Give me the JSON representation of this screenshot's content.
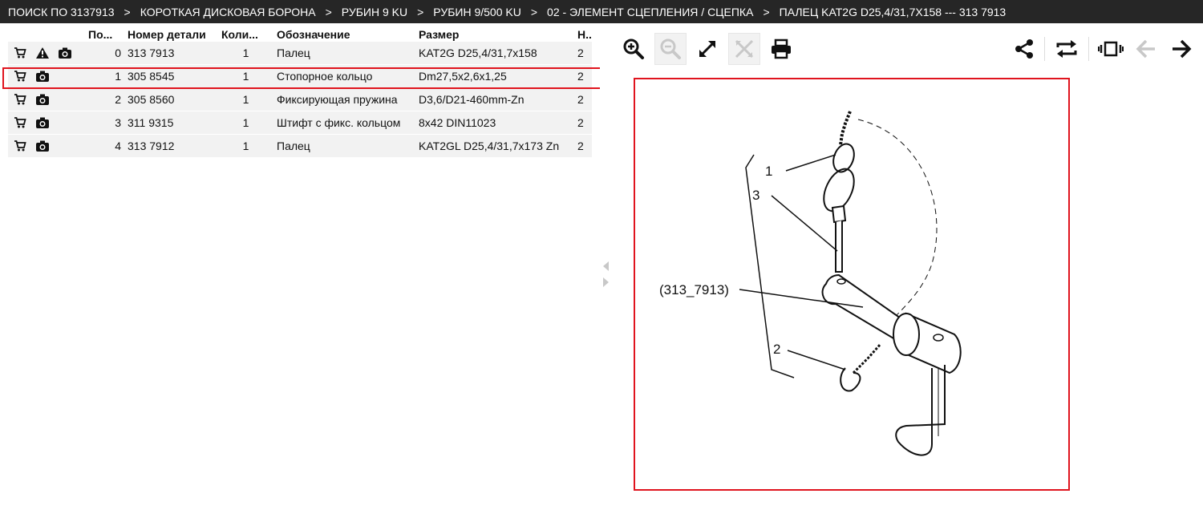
{
  "breadcrumb": [
    "ПОИСК ПО 3137913",
    "КОРОТКАЯ ДИСКОВАЯ БОРОНА",
    "РУБИН 9 KU",
    "РУБИН 9/500 KU",
    "02 - ЭЛЕМЕНТ СЦЕПЛЕНИЯ / СЦЕПКА",
    "ПАЛЕЦ KAT2G D25,4/31,7X158 --- 313 7913"
  ],
  "breadcrumb_separator": ">",
  "table": {
    "headers": {
      "pos": "По...",
      "part": "Номер детали",
      "qty": "Коли...",
      "name": "Обозначение",
      "size": "Размер",
      "n": "Н..."
    },
    "rows": [
      {
        "pos": "0",
        "part": "313 7913",
        "qty": "1",
        "name": "Палец",
        "size": "KAT2G D25,4/31,7x158",
        "n": "2",
        "warning": true
      },
      {
        "pos": "1",
        "part": "305 8545",
        "qty": "1",
        "name": "Стопорное кольцо",
        "size": "Dm27,5x2,6x1,25",
        "n": "2",
        "warning": false
      },
      {
        "pos": "2",
        "part": "305 8560",
        "qty": "1",
        "name": "Фиксирующая пружина",
        "size": "D3,6/D21-460mm-Zn",
        "n": "2",
        "warning": false
      },
      {
        "pos": "3",
        "part": "311 9315",
        "qty": "1",
        "name": "Штифт с фикс. кольцом",
        "size": "8x42 DIN11023",
        "n": "2",
        "warning": false
      },
      {
        "pos": "4",
        "part": "313 7912",
        "qty": "1",
        "name": "Палец",
        "size": "KAT2GL D25,4/31,7x173 Zn",
        "n": "2",
        "warning": false
      }
    ]
  },
  "drawing": {
    "labels": {
      "one": "1",
      "two": "2",
      "three": "3",
      "main": "(313_7913)"
    }
  },
  "colors": {
    "header_bg": "#262626",
    "highlight": "#e0141e",
    "row_bg": "#f2f2f2"
  }
}
